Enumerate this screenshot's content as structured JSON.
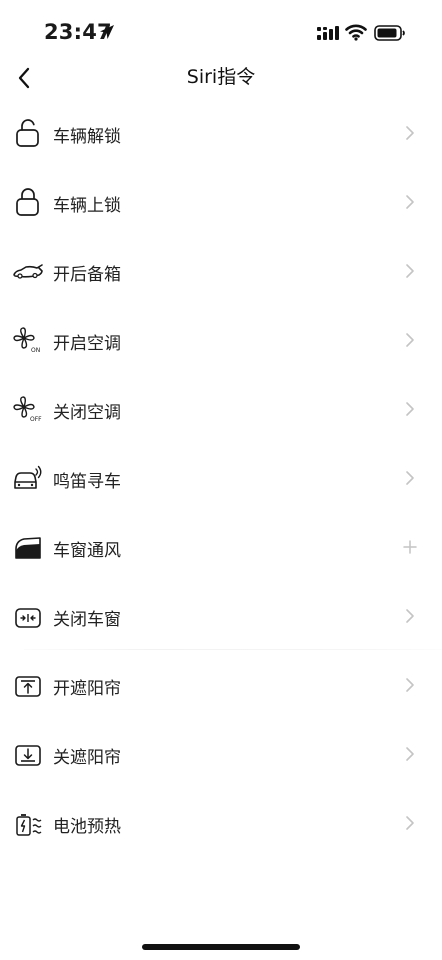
{
  "status_bar": {
    "time": "23:47",
    "icons": [
      "location-arrow-icon",
      "cellular-signal-icon",
      "wifi-icon",
      "battery-icon"
    ]
  },
  "nav": {
    "title": "Siri指令",
    "back_icon": "chevron-left-icon"
  },
  "commands": [
    {
      "label": "车辆解锁",
      "icon": "unlock-icon",
      "accessory": "chevron"
    },
    {
      "label": "车辆上锁",
      "icon": "lock-icon",
      "accessory": "chevron"
    },
    {
      "label": "开后备箱",
      "icon": "car-trunk-icon",
      "accessory": "chevron"
    },
    {
      "label": "开启空调",
      "icon": "fan-on-icon",
      "accessory": "chevron"
    },
    {
      "label": "关闭空调",
      "icon": "fan-off-icon",
      "accessory": "chevron"
    },
    {
      "label": "鸣笛寻车",
      "icon": "car-horn-icon",
      "accessory": "chevron"
    },
    {
      "label": "车窗通风",
      "icon": "window-vent-icon",
      "accessory": "plus"
    },
    {
      "label": "关闭车窗",
      "icon": "window-close-icon",
      "accessory": "chevron"
    },
    {
      "label": "开遮阳帘",
      "icon": "sunshade-open-icon",
      "accessory": "chevron"
    },
    {
      "label": "关遮阳帘",
      "icon": "sunshade-close-icon",
      "accessory": "chevron"
    },
    {
      "label": "电池预热",
      "icon": "battery-preheat-icon",
      "accessory": "chevron"
    }
  ],
  "colors": {
    "background": "#ffffff",
    "text": "#222222",
    "accessory": "#c4c4c4"
  }
}
